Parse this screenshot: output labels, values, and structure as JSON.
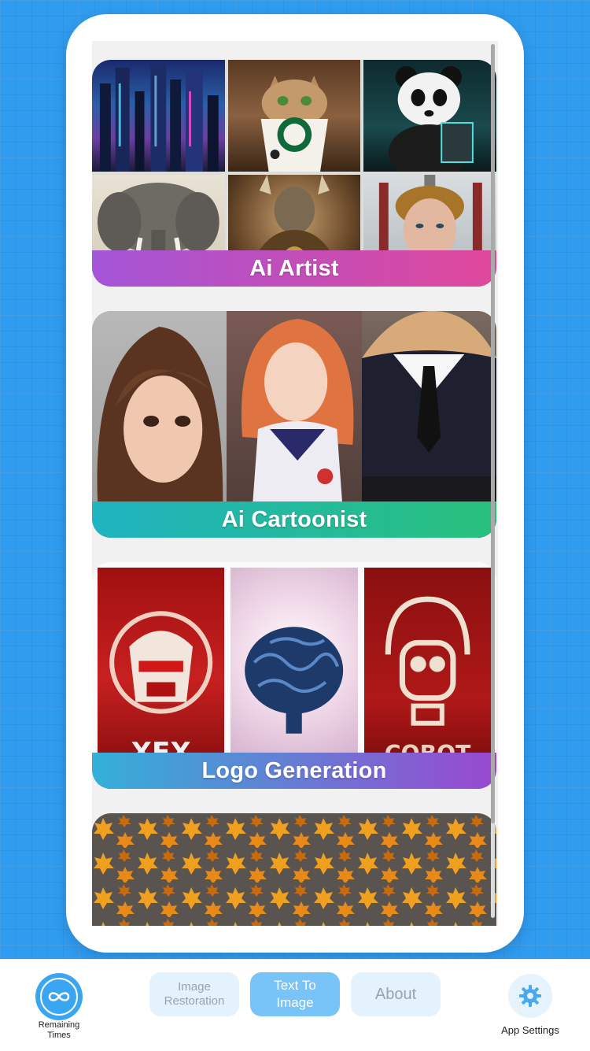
{
  "cards": {
    "ai_artist": {
      "label": "Ai Artist"
    },
    "ai_cartoonist": {
      "label": "Ai Cartoonist"
    },
    "logo_generation": {
      "label": "Logo Generation"
    }
  },
  "bottom_bar": {
    "remaining_label": "Remaining Times",
    "tabs": [
      {
        "label": "Image Restoration"
      },
      {
        "label": "Text To Image"
      },
      {
        "label": "About"
      }
    ],
    "settings_label": "App Settings"
  },
  "colors": {
    "background": "#2f9cf0",
    "accent": "#3aa6f2",
    "active_tab": "#78c3f7",
    "artist_banner_start": "#a455d8",
    "artist_banner_end": "#e0479a",
    "cartoonist_banner_start": "#20b3c2",
    "cartoonist_banner_end": "#27c07a",
    "logo_banner_start": "#33b0d8",
    "logo_banner_end": "#9a48d0"
  }
}
